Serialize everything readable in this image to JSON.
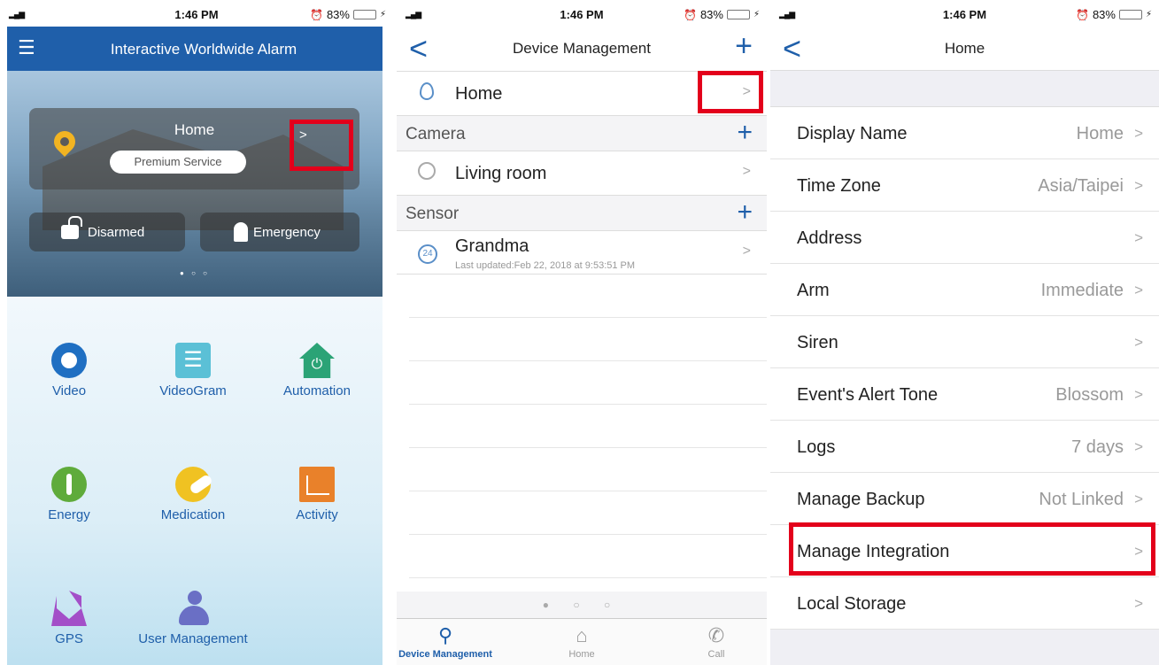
{
  "status": {
    "time": "1:46 PM",
    "battery": "83%",
    "signal": "▂▄▆"
  },
  "screen1": {
    "title": "Interactive Worldwide Alarm",
    "card": {
      "name": "Home",
      "service": "Premium Service",
      "arrow": ">"
    },
    "actions": {
      "disarmed": "Disarmed",
      "emergency": "Emergency"
    },
    "pager": "● ○ ○",
    "tiles": [
      {
        "label": "Video",
        "icon": "video-icon"
      },
      {
        "label": "VideoGram",
        "icon": "videogram-icon"
      },
      {
        "label": "Automation",
        "icon": "automation-icon"
      },
      {
        "label": "Energy",
        "icon": "energy-icon"
      },
      {
        "label": "Medication",
        "icon": "medication-icon"
      },
      {
        "label": "Activity",
        "icon": "activity-icon"
      },
      {
        "label": "GPS",
        "icon": "gps-icon"
      },
      {
        "label": "User Management",
        "icon": "user-management-icon"
      }
    ]
  },
  "screen2": {
    "title": "Device Management",
    "location": "Home",
    "camera_section": "Camera",
    "camera_device": "Living room",
    "sensor_section": "Sensor",
    "sensor_device": "Grandma",
    "sensor_updated": "Last updated:Feb 22, 2018 at 9:53:51 PM",
    "sensor_badge": "24",
    "pager": "● ○ ○",
    "tabs": {
      "device": "Device Management",
      "home": "Home",
      "call": "Call"
    }
  },
  "screen3": {
    "title": "Home",
    "rows": [
      {
        "label": "Display Name",
        "value": "Home"
      },
      {
        "label": "Time Zone",
        "value": "Asia/Taipei"
      },
      {
        "label": "Address",
        "value": ""
      },
      {
        "label": "Arm",
        "value": "Immediate"
      },
      {
        "label": "Siren",
        "value": ""
      },
      {
        "label": "Event's Alert Tone",
        "value": "Blossom"
      },
      {
        "label": "Logs",
        "value": "7 days"
      },
      {
        "label": "Manage Backup",
        "value": "Not Linked"
      },
      {
        "label": "Manage Integration",
        "value": ""
      },
      {
        "label": "Local Storage",
        "value": ""
      }
    ]
  },
  "colors": {
    "brand": "#1f5faa",
    "highlight": "#e3001b"
  }
}
